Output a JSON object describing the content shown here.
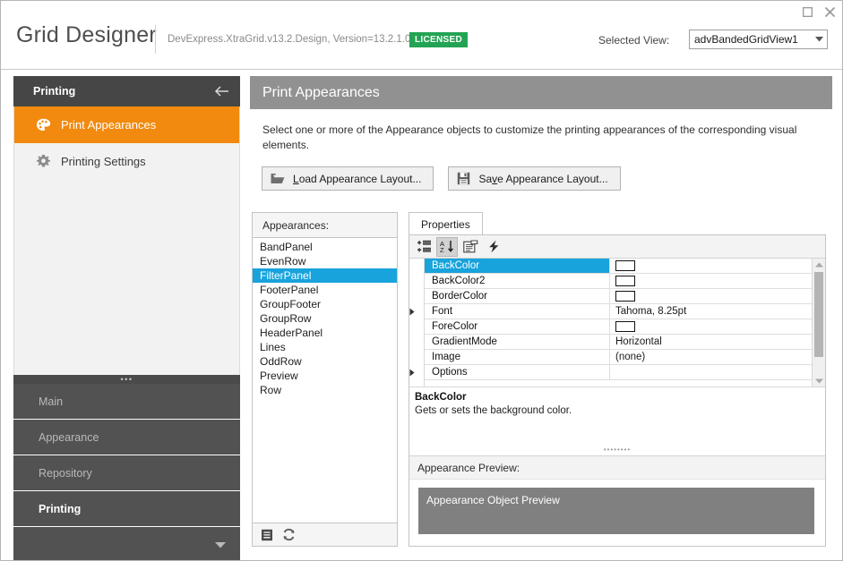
{
  "window": {
    "maximize_label": "Maximize",
    "close_label": "Close"
  },
  "header": {
    "app_title": "Grid Designer",
    "assembly_info": "DevExpress.XtraGrid.v13.2.Design, Version=13.2.1.0",
    "license_badge": "LICENSED",
    "selected_view_label": "Selected View:",
    "selected_view_value": "advBandedGridView1"
  },
  "sidebar": {
    "head_title": "Printing",
    "items": [
      {
        "label": "Print Appearances",
        "icon": "palette-icon",
        "active": true
      },
      {
        "label": "Printing Settings",
        "icon": "gear-icon",
        "active": false
      }
    ],
    "footer_items": [
      {
        "label": "Main",
        "selected": false
      },
      {
        "label": "Appearance",
        "selected": false
      },
      {
        "label": "Repository",
        "selected": false
      },
      {
        "label": "Printing",
        "selected": true
      }
    ]
  },
  "content": {
    "page_title": "Print Appearances",
    "page_description": "Select one or more of the Appearance objects to customize the printing appearances of the corresponding visual elements.",
    "buttons": [
      {
        "label_pre": "",
        "label_acc": "L",
        "label_post": "oad Appearance Layout...",
        "icon": "open-folder-icon"
      },
      {
        "label_pre": "Sa",
        "label_acc": "v",
        "label_post": "e Appearance Layout...",
        "icon": "save-disk-icon"
      }
    ]
  },
  "appearances": {
    "header": "Appearances:",
    "items": [
      "BandPanel",
      "EvenRow",
      "FilterPanel",
      "FooterPanel",
      "GroupFooter",
      "GroupRow",
      "HeaderPanel",
      "Lines",
      "OddRow",
      "Preview",
      "Row"
    ],
    "selected": "FilterPanel",
    "footer_buttons": [
      {
        "name": "list-icon"
      },
      {
        "name": "reset-refresh-icon"
      }
    ]
  },
  "properties": {
    "tab_label": "Properties",
    "toolbar": [
      {
        "name": "categorized-icon",
        "pressed": false
      },
      {
        "name": "alphabetical-sort-icon",
        "pressed": true
      },
      {
        "name": "property-pages-icon",
        "pressed": false
      },
      {
        "name": "events-lightning-icon",
        "pressed": false
      }
    ],
    "rows": [
      {
        "name": "BackColor",
        "value": "",
        "type": "color",
        "expandable": false,
        "selected": true
      },
      {
        "name": "BackColor2",
        "value": "",
        "type": "color",
        "expandable": false,
        "selected": false
      },
      {
        "name": "BorderColor",
        "value": "",
        "type": "color",
        "expandable": false,
        "selected": false
      },
      {
        "name": "Font",
        "value": "Tahoma, 8.25pt",
        "type": "text",
        "expandable": true,
        "selected": false
      },
      {
        "name": "ForeColor",
        "value": "",
        "type": "color",
        "expandable": false,
        "selected": false
      },
      {
        "name": "GradientMode",
        "value": "Horizontal",
        "type": "text",
        "expandable": false,
        "selected": false
      },
      {
        "name": "Image",
        "value": "(none)",
        "type": "text",
        "expandable": false,
        "selected": false
      },
      {
        "name": "Options",
        "value": "",
        "type": "text",
        "expandable": true,
        "selected": false
      }
    ],
    "description_title": "BackColor",
    "description_text": "Gets or sets the background color.",
    "preview_header": "Appearance Preview:",
    "preview_label": "Appearance Object Preview",
    "preview_color": "#808080"
  },
  "colors": {
    "accent_blue": "#18a3dc",
    "accent_orange": "#f18a0e",
    "license_green": "#23a455",
    "header_gray": "#919191",
    "sidebar_dark": "#464646"
  }
}
